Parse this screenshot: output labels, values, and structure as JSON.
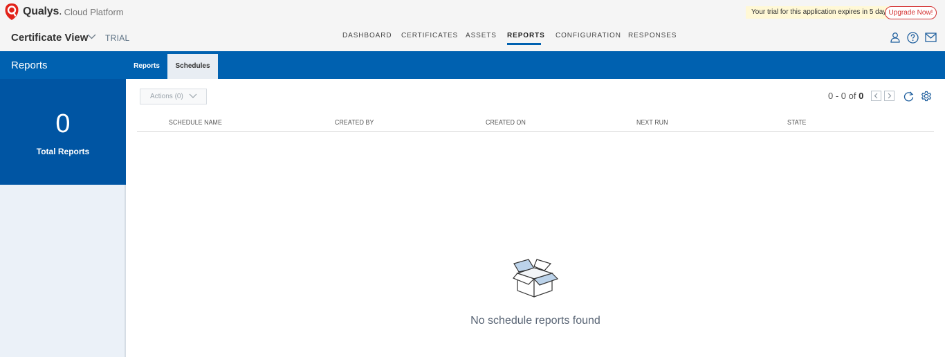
{
  "brand": {
    "name": "Qualys",
    "dot": ".",
    "platform": "Cloud Platform",
    "logo_icon": "qualys-shield-logo"
  },
  "trial_banner": {
    "message": "Your trial for this application expires in 5 days.",
    "upgrade_label": "Upgrade Now!"
  },
  "app": {
    "title": "Certificate View",
    "badge": "TRIAL"
  },
  "nav": {
    "items": [
      "DASHBOARD",
      "CERTIFICATES",
      "ASSETS",
      "REPORTS",
      "CONFIGURATION",
      "RESPONSES"
    ],
    "active": "REPORTS"
  },
  "header_icons": [
    "user-icon",
    "help-icon",
    "mail-icon"
  ],
  "band": {
    "title": "Reports",
    "tabs": [
      {
        "label": "Reports",
        "active": false
      },
      {
        "label": "Schedules",
        "active": true
      }
    ]
  },
  "stats": {
    "value": "0",
    "label": "Total Reports"
  },
  "toolbar": {
    "actions_label": "Actions (0)"
  },
  "pager": {
    "range": "0 - 0 of",
    "total": "0"
  },
  "table": {
    "columns": [
      "SCHEDULE NAME",
      "CREATED BY",
      "CREATED ON",
      "NEXT RUN",
      "STATE"
    ],
    "rows": []
  },
  "empty_state": {
    "icon": "open-box-icon",
    "message": "No schedule reports found"
  },
  "colors": {
    "primary_blue": "#0061b0",
    "stat_blue": "#0055a3",
    "upgrade_red": "#d32f2f",
    "trial_yellow": "#fff8d6"
  }
}
